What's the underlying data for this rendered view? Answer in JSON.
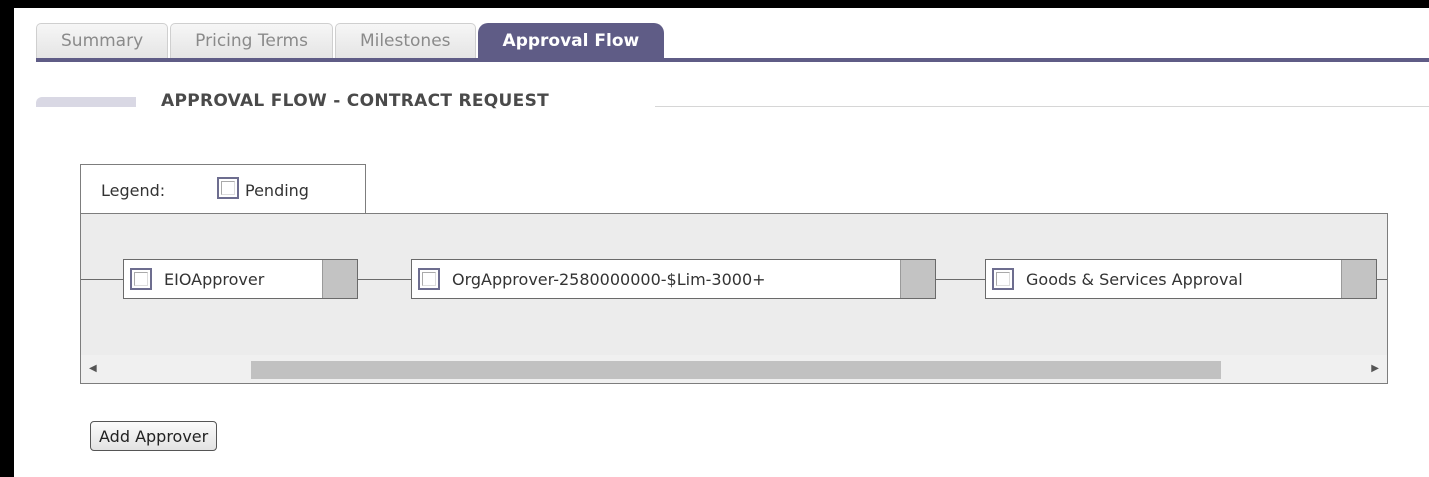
{
  "tabs": [
    {
      "label": "Summary"
    },
    {
      "label": "Pricing Terms"
    },
    {
      "label": "Milestones"
    },
    {
      "label": "Approval Flow"
    }
  ],
  "section": {
    "title": "APPROVAL FLOW - CONTRACT REQUEST"
  },
  "legend": {
    "label": "Legend:",
    "pending": "Pending"
  },
  "flow": {
    "nodes": [
      {
        "label": "EIOApprover"
      },
      {
        "label": "OrgApprover-2580000000-$Lim-3000+"
      },
      {
        "label": "Goods & Services Approval"
      }
    ]
  },
  "actions": {
    "add_approver": "Add Approver"
  }
}
